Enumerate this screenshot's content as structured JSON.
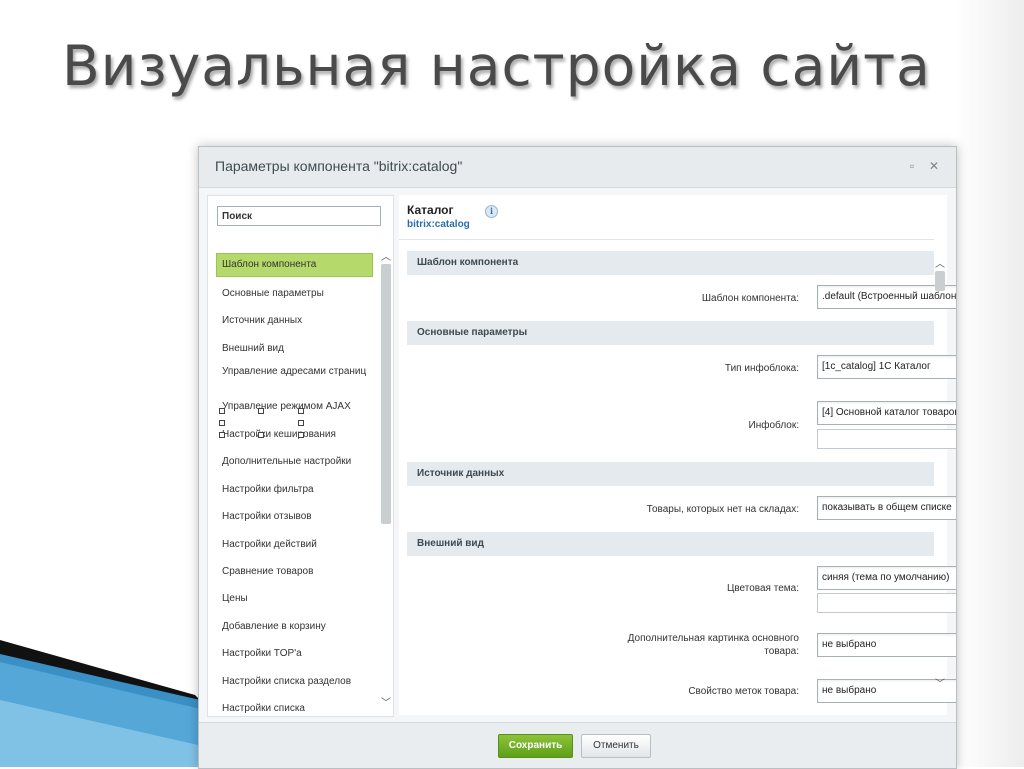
{
  "slide": {
    "title": "Визуальная настройка сайта"
  },
  "dialog": {
    "title": "Параметры компонента \"bitrix:catalog\"",
    "search": {
      "value": "Поиск"
    },
    "left_items": [
      "Шаблон компонента",
      "Основные параметры",
      "Источник данных",
      "Внешний вид",
      "Управление адресами страниц",
      "Управление режимом AJAX",
      "Настройки кеширования",
      "Дополнительные настройки",
      "Настройки фильтра",
      "Настройки отзывов",
      "Настройки действий",
      "Сравнение товаров",
      "Цены",
      "Добавление в корзину",
      "Настройки TOP'а",
      "Настройки списка разделов",
      "Настройки списка"
    ],
    "component": {
      "title": "Каталог",
      "code": "bitrix:catalog"
    },
    "sections": {
      "template": "Шаблон компонента",
      "basic": "Основные параметры",
      "source": "Источник данных",
      "view": "Внешний вид"
    },
    "fields": {
      "template": {
        "label": "Шаблон компонента:",
        "value": ".default (Встроенный шаблон)"
      },
      "iblock_type": {
        "label": "Тип инфоблока:",
        "value": "[1c_catalog] 1С Каталог"
      },
      "iblock": {
        "label": "Инфоблок:",
        "value": "[4] Основной каталог товаров",
        "ok": "ok"
      },
      "not_in_stock": {
        "label": "Товары, которых нет на складах:",
        "value": "показывать в общем списке"
      },
      "color_theme": {
        "label": "Цветовая тема:",
        "value": "синяя (тема по умолчанию)"
      },
      "extra_picture": {
        "label": "Дополнительная картинка основного товара:",
        "value": "не выбрано"
      },
      "label_prop": {
        "label": "Свойство меток товара:",
        "value": "не выбрано"
      }
    },
    "buttons": {
      "save": "Сохранить",
      "cancel": "Отменить"
    }
  },
  "colors": {
    "accent_green": "#8cc33a",
    "link_blue": "#2a6fb0",
    "active_item": "#b6d96c"
  },
  "icons": [
    "maximize-icon",
    "close-icon",
    "info-icon",
    "chevron-down-icon",
    "scroll-up-icon",
    "scroll-down-icon"
  ]
}
